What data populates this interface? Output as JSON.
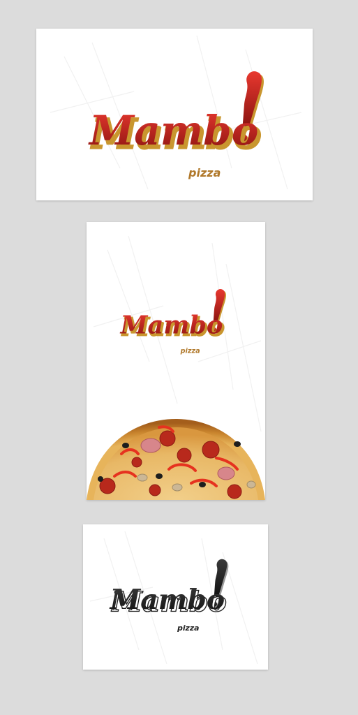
{
  "brand": {
    "name": "Mambo",
    "mark": "!",
    "subtitle": "pizza"
  },
  "colors": {
    "background": "#dcdcdc",
    "card": "#ffffff",
    "red_top": "#e0302a",
    "red_bottom": "#8e1410",
    "gold": "#c9962e",
    "pizza_label": "#b0782a",
    "black": "#1e1e1e",
    "black_shadow": "#9a9a9a"
  },
  "cards": [
    {
      "id": "business-card",
      "variant": "red"
    },
    {
      "id": "menu-cover",
      "variant": "red",
      "image": "pizza"
    },
    {
      "id": "monochrome-card",
      "variant": "black"
    }
  ]
}
